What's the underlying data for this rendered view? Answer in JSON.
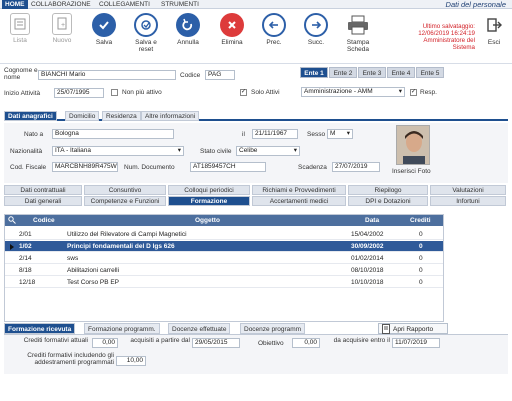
{
  "menu": {
    "tabs": [
      "HOME",
      "COLLABORAZIONE",
      "COLLEGAMENTI",
      "STRUMENTI"
    ],
    "active": "HOME"
  },
  "page_title": "Dati del personale",
  "toolbar": {
    "buttons": [
      {
        "label": "Lista",
        "icon": "list-icon"
      },
      {
        "label": "Nuovo",
        "icon": "new-doc-icon"
      },
      {
        "label": "Salva",
        "icon": "check-icon"
      },
      {
        "label": "Salva e reset",
        "icon": "save-reset-icon"
      },
      {
        "label": "Annulla",
        "icon": "undo-icon"
      },
      {
        "label": "Elimina",
        "icon": "delete-icon"
      },
      {
        "label": "Prec.",
        "icon": "arrow-left-icon"
      },
      {
        "label": "Succ.",
        "icon": "arrow-right-icon"
      },
      {
        "label": "Stampa Scheda",
        "icon": "print-icon"
      }
    ],
    "exit_label": "Esci",
    "save_status_line1": "Ultimo salvataggio:",
    "save_status_line2": "12/06/2019 16:24:19",
    "save_status_line3": "Amministratore del",
    "save_status_line4": "Sistema"
  },
  "header": {
    "cognome_label": "Cognome e nome",
    "cognome_value": "BIANCHI Mario",
    "codice_label": "Codice",
    "codice_value": "PAG",
    "inizio_label": "Inizio Attività",
    "inizio_value": "25/07/1995",
    "non_piu_attivo_label": "Non più attivo",
    "solo_attivi_label": "Solo Attivi",
    "ente_tabs": [
      "Ente 1",
      "Ente 2",
      "Ente 3",
      "Ente 4",
      "Ente 5"
    ],
    "ente_value": "Amministrazione - AMM",
    "resp_label": "Resp."
  },
  "section_tabs": [
    "Dati anagrafici",
    "Domicilio",
    "Residenza",
    "Altre informazioni"
  ],
  "anagrafici": {
    "nato_label": "Nato a",
    "nato_value": "Bologna",
    "il_label": "il",
    "il_value": "21/11/1967",
    "sesso_label": "Sesso",
    "sesso_value": "M",
    "naz_label": "Nazionalità",
    "naz_value": "ITA - Italiana",
    "stato_label": "Stato civile",
    "stato_value": "Celibe",
    "cf_label": "Cod. Fiscale",
    "cf_value": "MARCBNH89R475W",
    "doc_label": "Num. Documento",
    "doc_value": "AT1859457CH",
    "scad_label": "Scadenza",
    "scad_value": "27/07/2019",
    "foto_label": "Inserisci Foto"
  },
  "subtabs_row1": [
    "Dati contrattuali",
    "Consuntivo",
    "Colloqui periodici",
    "Richiami e Provvedimenti",
    "Riepilogo",
    "Valutazioni"
  ],
  "subtabs_row2": [
    "Dati generali",
    "Competenze e Funzioni",
    "Formazione",
    "Accertamenti medici",
    "DPI e Dotazioni",
    "Infortuni"
  ],
  "grid": {
    "columns": [
      "Codice",
      "Oggetto",
      "Data",
      "Crediti"
    ],
    "rows": [
      {
        "codice": "2/01",
        "oggetto": "Utilizzo del Rilevatore di Campi Magnetici",
        "data": "15/04/2002",
        "crediti": "0"
      },
      {
        "codice": "1/02",
        "oggetto": "Principi fondamentali del D lgs 626",
        "data": "30/09/2002",
        "crediti": "0"
      },
      {
        "codice": "2/14",
        "oggetto": "sws",
        "data": "01/02/2014",
        "crediti": "0"
      },
      {
        "codice": "8/18",
        "oggetto": "Abilitazioni carrelli",
        "data": "08/10/2018",
        "crediti": "0"
      },
      {
        "codice": "12/18",
        "oggetto": "Test Corso PB EP",
        "data": "10/10/2018",
        "crediti": "0"
      }
    ]
  },
  "bottom_tabs": [
    "Formazione ricevuta",
    "Formazione programm.",
    "Docenze effettuate",
    "Docenze programm"
  ],
  "apri_rapporto": "Apri Rapporto",
  "bottom": {
    "crediti_label": "Crediti formativi attuali",
    "crediti_value": "0,00",
    "acquisiti_label": "acquisiti a partire dal",
    "acquisiti_value": "29/05/2015",
    "obiettivo_label": "Obiettivo",
    "obiettivo_value": "0,00",
    "entro_label": "da acquisire entro il",
    "entro_value": "11/07/2019",
    "incl_label": "Crediti formativi includendo gli addestramenti programmati",
    "incl_value": "10,00"
  }
}
